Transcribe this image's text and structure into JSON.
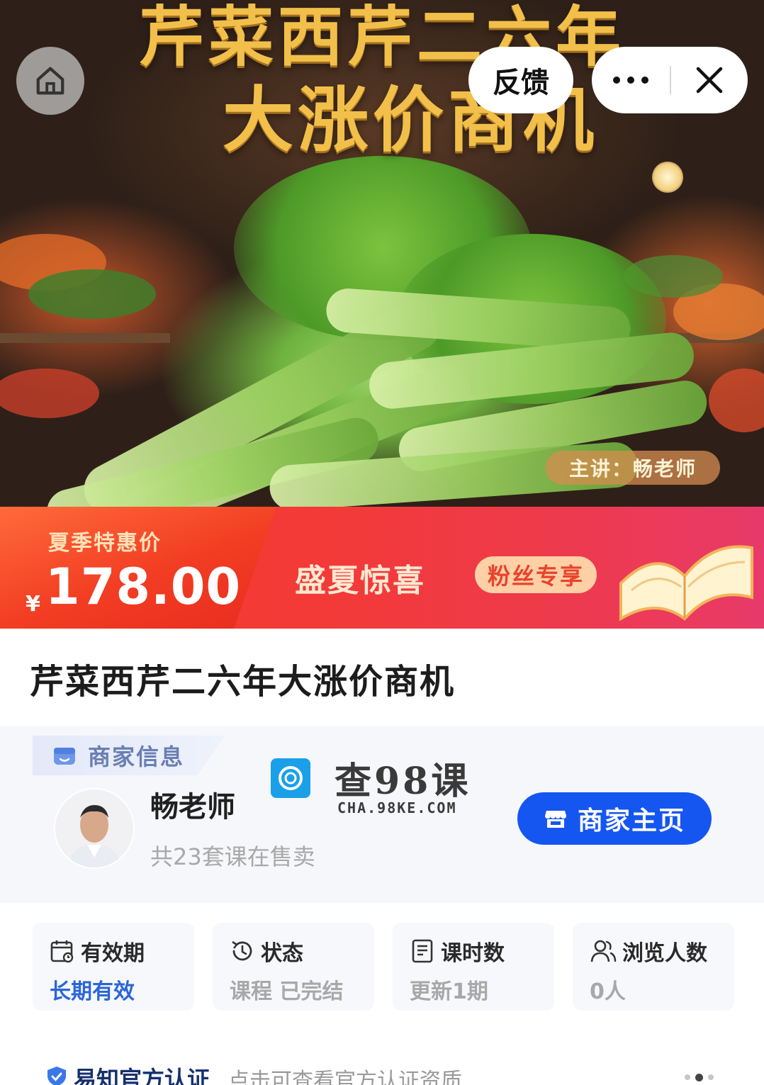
{
  "hero": {
    "title_line1": "芹菜西芹二六年",
    "title_line2": "大涨价商机",
    "lecturer_tag": "主讲：畅老师"
  },
  "nav": {
    "home_icon": "home-icon",
    "feedback_label": "反馈",
    "more_icon": "more-icon",
    "close_icon": "close-icon"
  },
  "price_banner": {
    "label": "夏季特惠价",
    "currency": "¥",
    "price": "178.00",
    "promo_main": "盛夏惊喜",
    "promo_tag": "粉丝专享"
  },
  "course": {
    "title": "芹菜西芹二六年大涨价商机"
  },
  "merchant": {
    "section_label": "商家信息",
    "name": "畅老师",
    "course_count": "共23套课在售卖",
    "home_button": "商家主页",
    "watermark_text": "查98课",
    "watermark_url": "CHA.98KE.COM"
  },
  "stats": [
    {
      "label": "有效期",
      "value": "长期有效",
      "icon": "calendar-icon"
    },
    {
      "label": "状态",
      "value": "课程 已完结",
      "icon": "history-icon"
    },
    {
      "label": "课时数",
      "value": "更新1期",
      "icon": "document-icon"
    },
    {
      "label": "浏览人数",
      "value": "0人",
      "icon": "users-icon"
    }
  ],
  "certification": {
    "title": "易知官方认证",
    "desc": "点击可查看官方认证资质"
  },
  "colors": {
    "accent_blue": "#1656f0",
    "price_red": "#f23d23",
    "title_gold": "#f2c04a"
  }
}
